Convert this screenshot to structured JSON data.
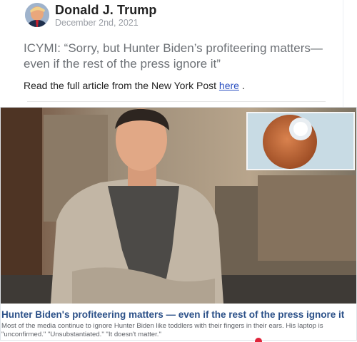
{
  "post": {
    "author": "Donald J. Trump",
    "date": "December 2nd, 2021",
    "text": "ICYMI: “Sorry, but Hunter Biden’s profiteering matters—even if the rest of the press ignore it”",
    "read_prefix": "Read the full article from the New York Post",
    "link_label": "here",
    "read_suffix": "."
  },
  "article": {
    "title": "Hunter Biden's profiteering matters — even if the rest of the press ignore it",
    "description": "Most of the media continue to ignore Hunter Biden like toddlers with their fingers in their ears. His laptop is \"unconfirmed.\" \"Unsubstantiated.\" \"It doesn't matter.\""
  },
  "colors": {
    "link": "#2a4fc0",
    "article_title": "#2b5088",
    "notification": "#e0243a"
  }
}
